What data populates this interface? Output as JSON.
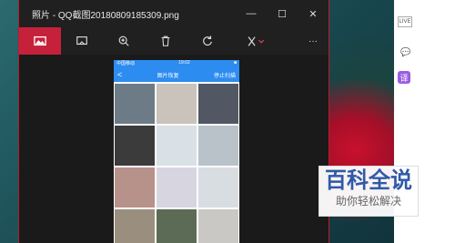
{
  "window": {
    "title": "照片 - QQ截图20180809185309.png",
    "controls": {
      "minimize": "—",
      "maximize": "☐",
      "close": "✕"
    }
  },
  "toolbar": {
    "items": [
      {
        "name": "image-icon",
        "active": true
      },
      {
        "name": "slideshow-icon",
        "active": false
      },
      {
        "name": "zoom-icon",
        "active": false
      },
      {
        "name": "delete-icon",
        "active": false
      },
      {
        "name": "rotate-icon",
        "active": false
      },
      {
        "name": "edit-icon",
        "active": false
      },
      {
        "name": "more-icon",
        "active": false
      }
    ],
    "more_label": "···"
  },
  "phone": {
    "status_left": "中国移动",
    "status_mid": "19:02",
    "status_right": "■",
    "back": "<",
    "header_title": "图片恢复",
    "header_action": "停止扫描",
    "grid_colors": [
      "#6d7b87",
      "#c9c3bb",
      "#515863",
      "#3b3b3b",
      "#d9e0e6",
      "#b8c2c8",
      "#b7928a",
      "#d7d6e0",
      "#d8dde2",
      "#9a8f7e",
      "#5c6b55",
      "#c9c8c4"
    ]
  },
  "right_panel": {
    "live": "LIVE",
    "comment": "💬",
    "translate": "译"
  },
  "watermark": {
    "big": "百科全说",
    "small": "助你轻松解决"
  }
}
